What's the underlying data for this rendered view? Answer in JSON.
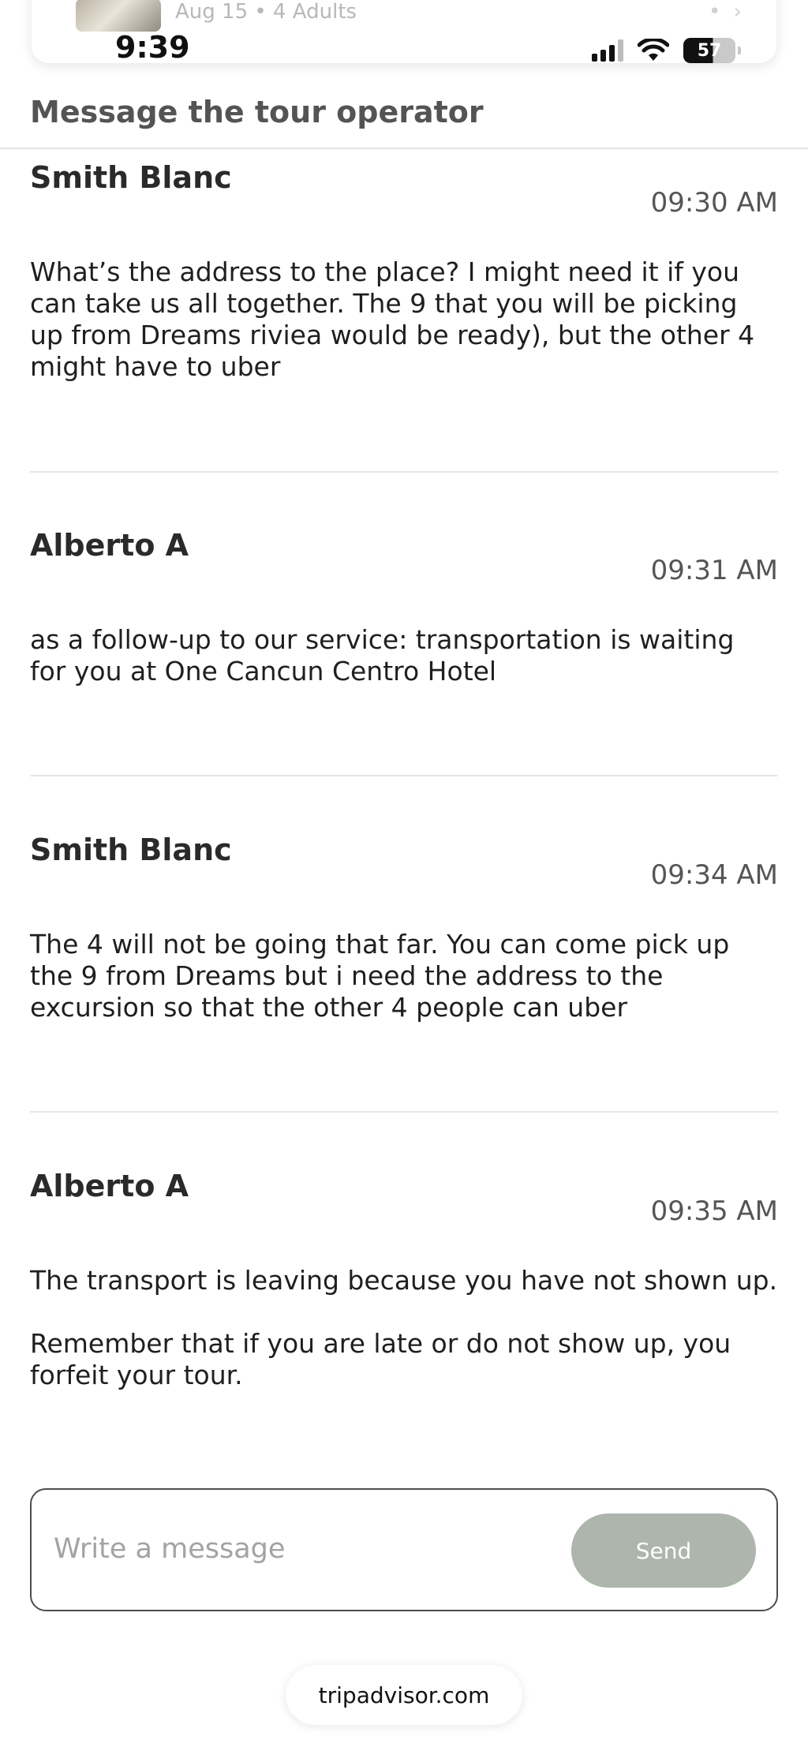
{
  "booking_card": {
    "meta": "Aug 15 • 4 Adults"
  },
  "status_bar": {
    "time": "9:39",
    "battery": "57"
  },
  "header": {
    "title": "Message the tour operator"
  },
  "messages": [
    {
      "sender": "Smith Blanc",
      "time": "09:30 AM",
      "body": "What’s the address to the place? I might need it if you can take us all together. The 9 that you will be picking up from Dreams riviea would be ready), but the other 4 might have to uber"
    },
    {
      "sender": "Alberto A",
      "time": "09:31 AM",
      "body": "as a follow-up to our service: transportation is waiting for you at One Cancun Centro Hotel"
    },
    {
      "sender": "Smith Blanc",
      "time": "09:34 AM",
      "body": "The 4 will not be going that far.  You can come pick up the 9 from Dreams but i need the address to the excursion so that the other 4 people can uber"
    },
    {
      "sender": "Alberto A",
      "time": "09:35 AM",
      "body": "The transport is leaving because you have not shown up.\n\nRemember that if you are late or do not show up, you forfeit your tour."
    }
  ],
  "composer": {
    "placeholder": "Write a message",
    "send_label": "Send"
  },
  "browser": {
    "domain": "tripadvisor.com"
  }
}
